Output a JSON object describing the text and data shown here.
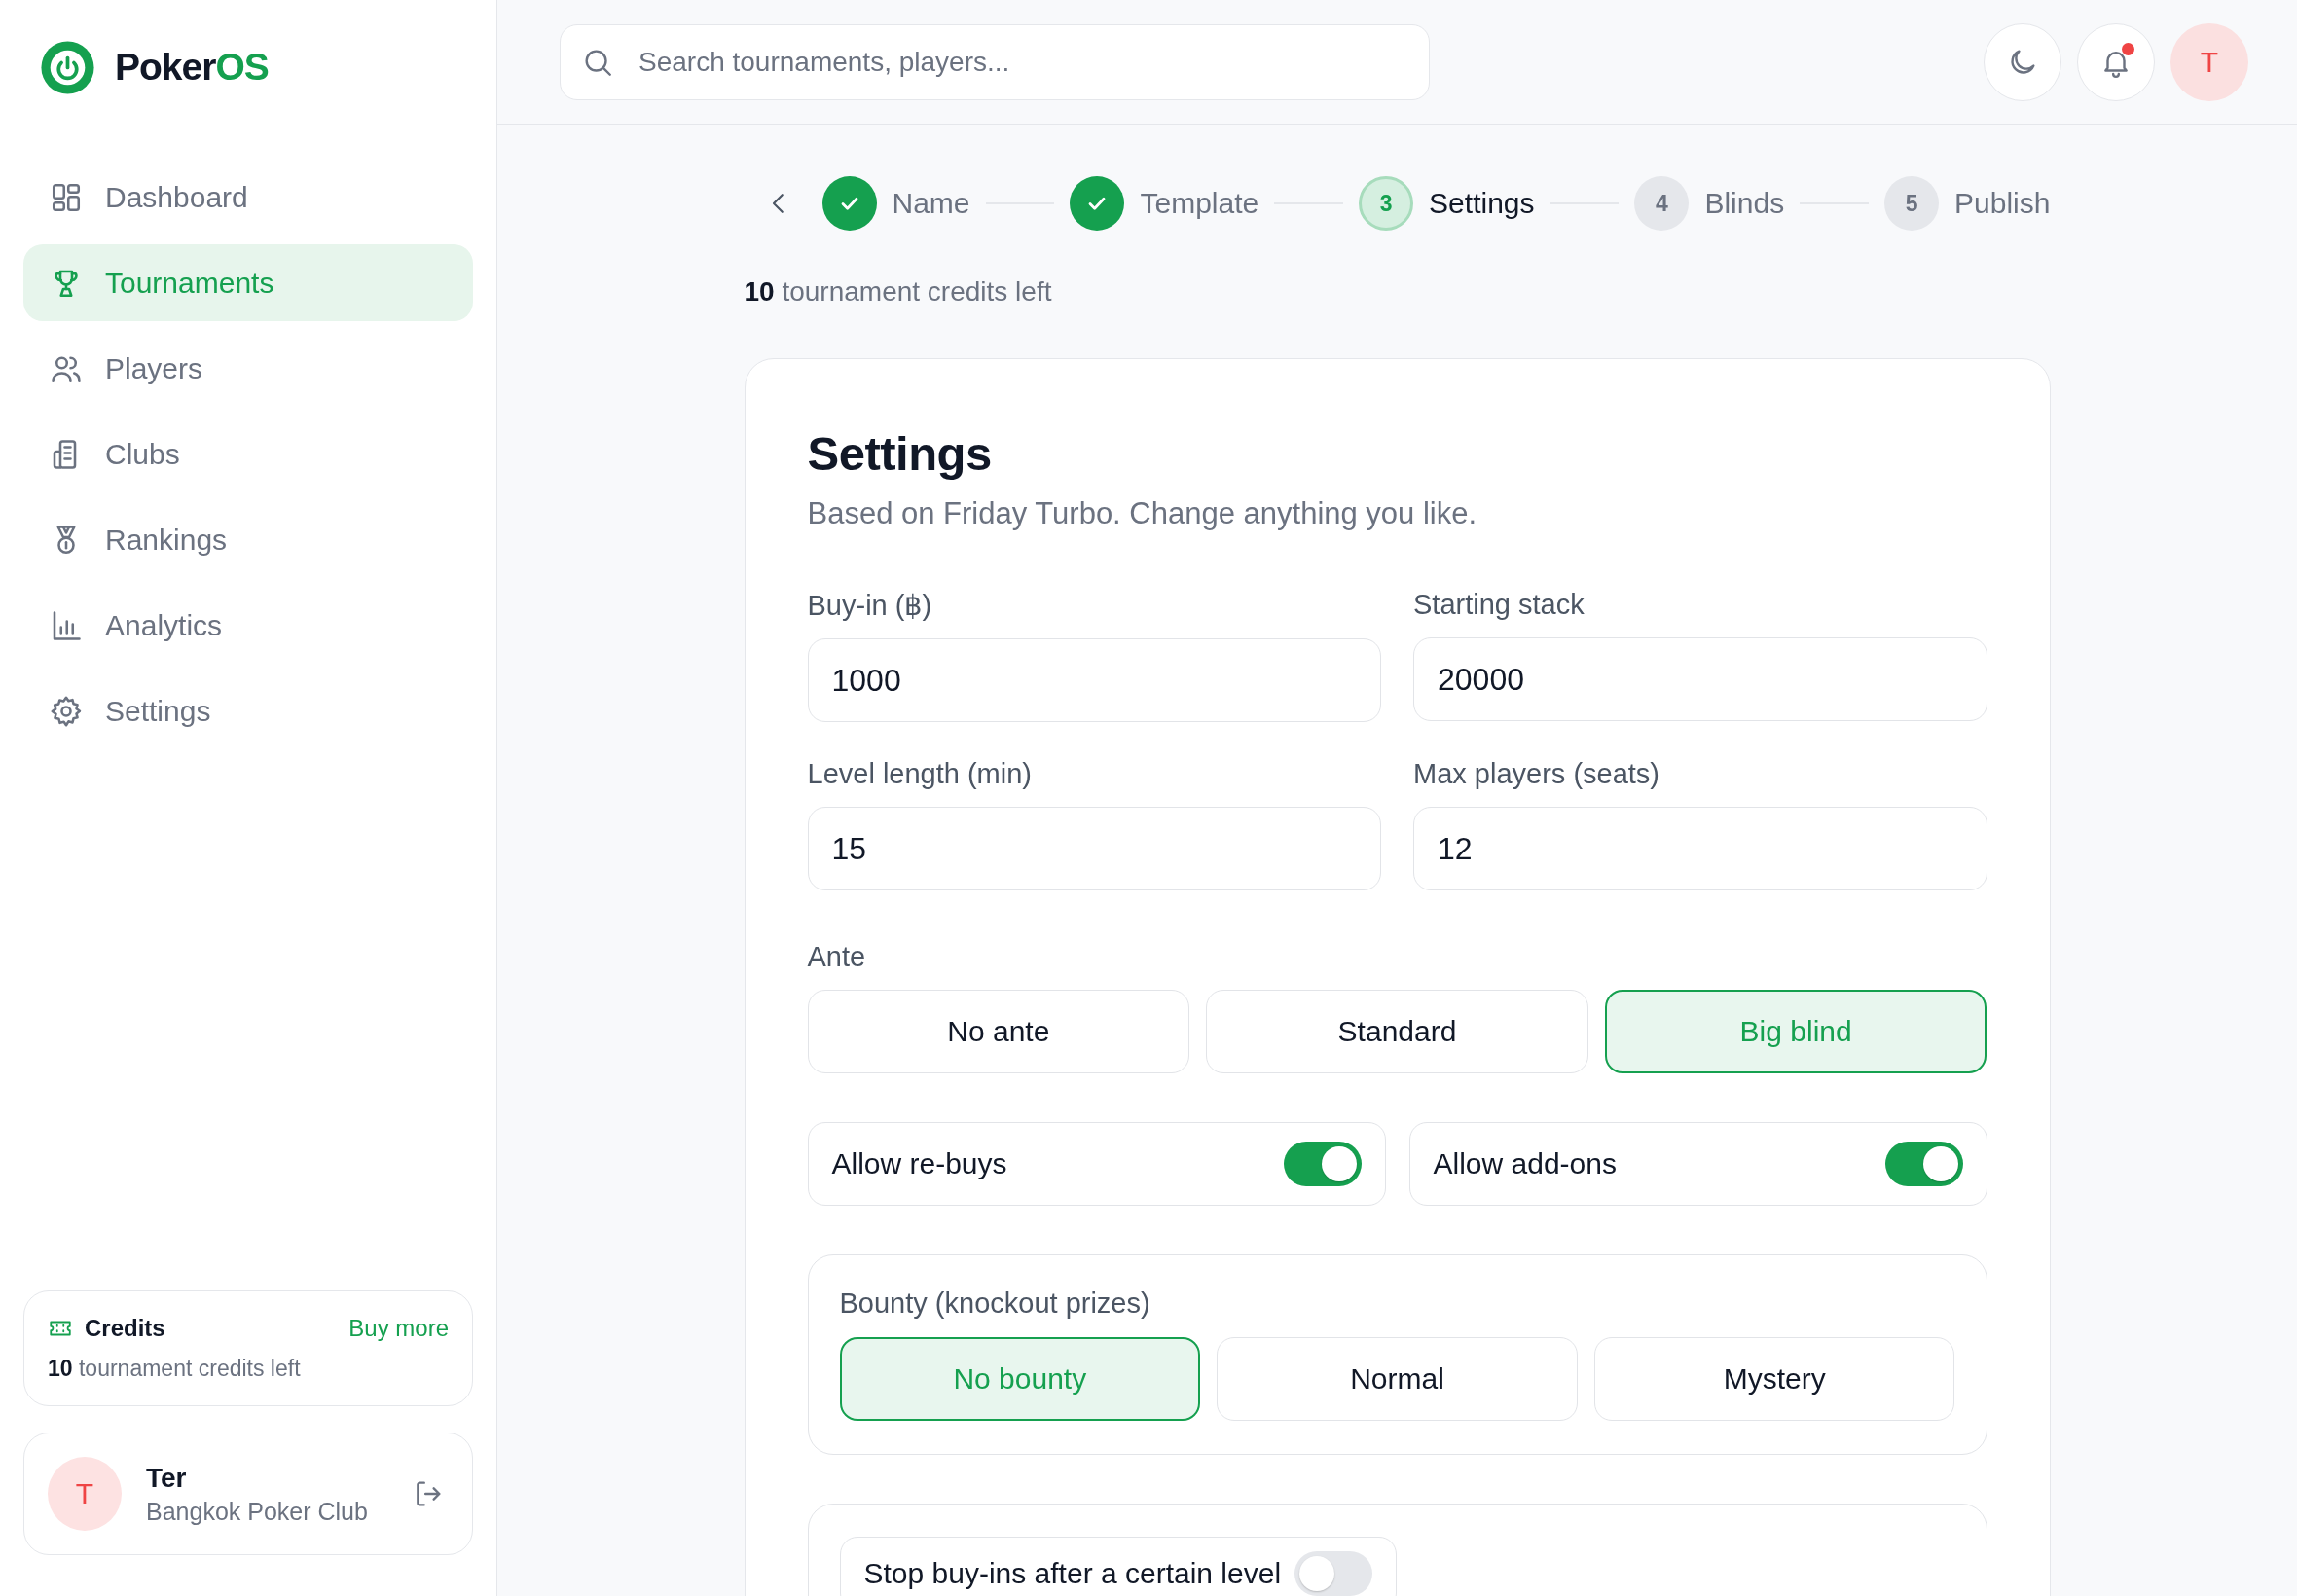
{
  "app": {
    "name": "Poker",
    "name_accent": "OS"
  },
  "sidebar": {
    "items": [
      {
        "label": "Dashboard",
        "selected": false
      },
      {
        "label": "Tournaments",
        "selected": true
      },
      {
        "label": "Players",
        "selected": false
      },
      {
        "label": "Clubs",
        "selected": false
      },
      {
        "label": "Rankings",
        "selected": false
      },
      {
        "label": "Analytics",
        "selected": false
      },
      {
        "label": "Settings",
        "selected": false
      }
    ],
    "credits": {
      "title": "Credits",
      "action": "Buy more",
      "text": "**10** tournament credits left"
    },
    "user": {
      "initial": "T",
      "name": "Ter",
      "club": "Bangkok Poker Club"
    }
  },
  "header": {
    "search": {
      "placeholder": "Search tournaments, players..."
    },
    "notification": true,
    "avatar": "T"
  },
  "stepper": {
    "steps": [
      {
        "label": "Name",
        "done": true,
        "selected": false
      },
      {
        "label": "Template",
        "done": true,
        "selected": false
      },
      {
        "label": "Settings",
        "done": false,
        "selected": true,
        "number": "3"
      },
      {
        "label": "Blinds",
        "done": false,
        "selected": false,
        "number": "4"
      },
      {
        "label": "Publish",
        "done": false,
        "selected": false,
        "number": "5"
      }
    ]
  },
  "credits_note": "**10** tournament credits left",
  "form": {
    "title": "Settings",
    "subtitle": "Based on Friday Turbo. Change anything you like.",
    "fields": [
      {
        "label": "Buy-in (฿)",
        "value": "1000"
      },
      {
        "label": "Starting stack",
        "value": "20000"
      },
      {
        "label": "Level length (min)",
        "value": "15"
      },
      {
        "label": "Max players (seats)",
        "value": "12"
      }
    ],
    "ante": {
      "label": "Ante",
      "options": [
        {
          "label": "No ante",
          "selected": false
        },
        {
          "label": "Standard",
          "selected": false
        },
        {
          "label": "Big blind",
          "selected": true
        }
      ]
    },
    "toggles": [
      {
        "label": "Allow re-buys",
        "on": true
      },
      {
        "label": "Allow add-ons",
        "on": true
      }
    ],
    "bounty": {
      "label": "Bounty (knockout prizes)",
      "options": [
        {
          "label": "No bounty",
          "selected": true
        },
        {
          "label": "Normal",
          "selected": false
        },
        {
          "label": "Mystery",
          "selected": false
        }
      ]
    },
    "limit": {
      "label": "Stop buy-ins after a certain level",
      "on": false
    }
  }
}
